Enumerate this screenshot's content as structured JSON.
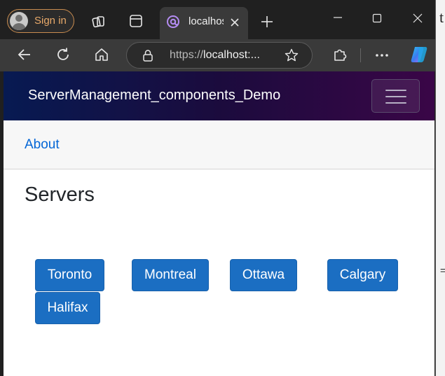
{
  "browser": {
    "sign_in_label": "Sign in",
    "tab": {
      "title": "localhost",
      "favicon": "blazor-icon"
    },
    "address": {
      "url_prefix": "https://",
      "url_host": "localhost:..."
    },
    "colors": {
      "sign_in_accent": "#e8a96a",
      "tab_active": "#3a3a3a",
      "frame": "#202020"
    }
  },
  "app": {
    "brand": "ServerManagement_components_Demo",
    "nav": {
      "about_label": "About"
    },
    "page_title": "Servers",
    "servers": [
      {
        "name": "Toronto"
      },
      {
        "name": "Montreal"
      },
      {
        "name": "Ottawa"
      },
      {
        "name": "Calgary"
      },
      {
        "name": "Halifax"
      }
    ],
    "colors": {
      "button_bg": "#1b6ec2",
      "link": "#0366d6",
      "navbar_start": "#071a52",
      "navbar_end": "#3a0647"
    }
  }
}
